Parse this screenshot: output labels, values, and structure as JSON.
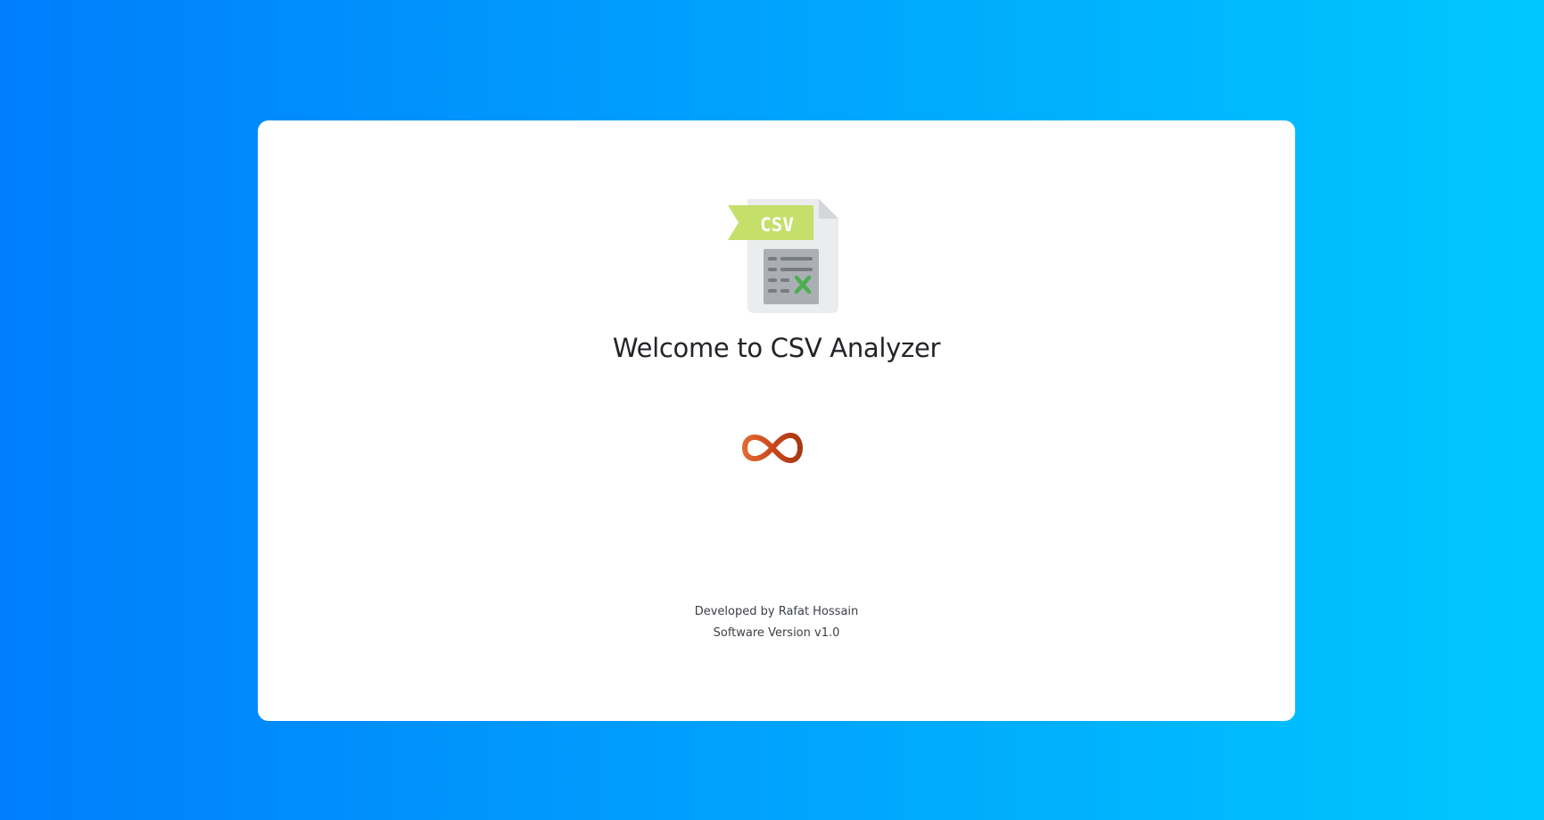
{
  "app": {
    "welcome_text": "Welcome to CSV Analyzer",
    "developer_text": "Developed by Rafat Hossain",
    "version_text": "Software Version v1.0"
  },
  "logo": {
    "badge_text": "CSV",
    "icon": "csv-file-icon",
    "badge_color": "#c5df6b",
    "check_color": "#4caf50"
  },
  "loader": {
    "icon": "infinity-loader-icon",
    "color": "#c9481d"
  },
  "colors": {
    "background_start": "#007efc",
    "background_end": "#00c8fe",
    "card": "#ffffff",
    "title_text": "#222428"
  }
}
